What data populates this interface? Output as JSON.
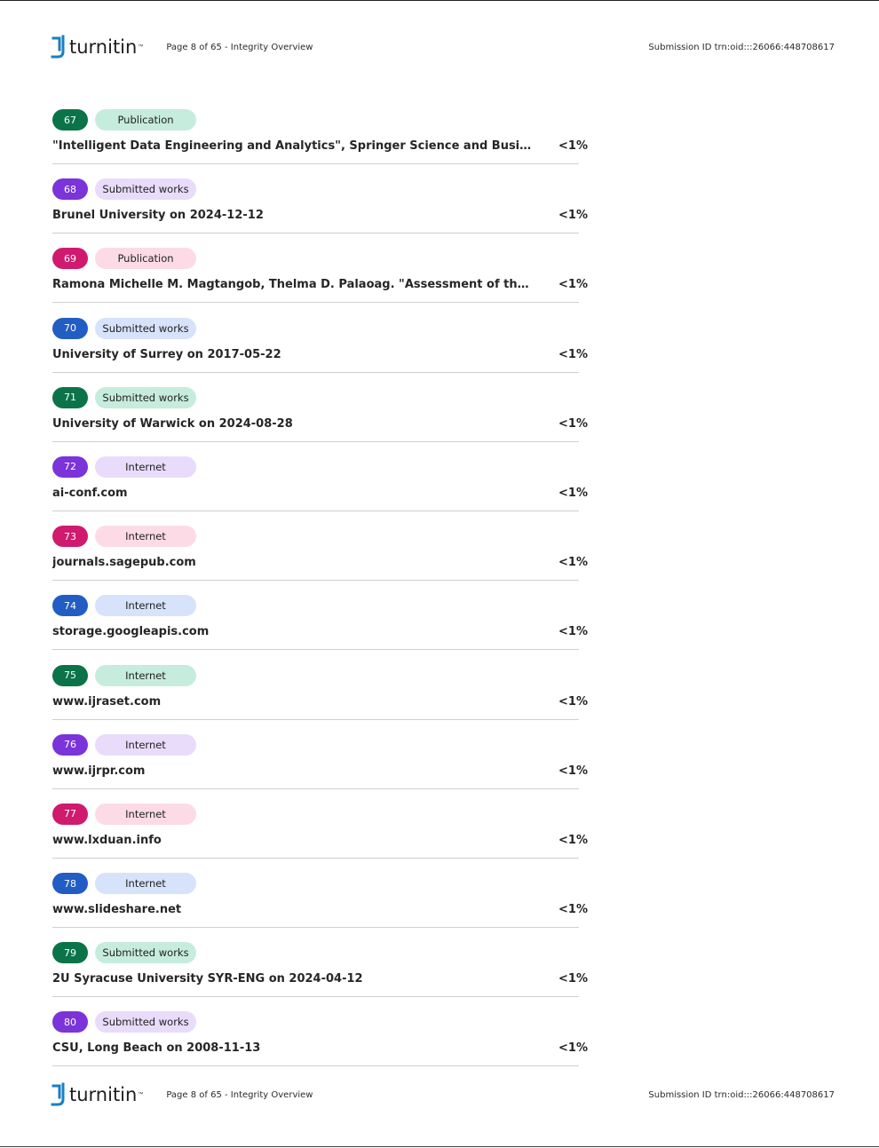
{
  "header": {
    "logo_text": "turnitin",
    "page_info": "Page 8 of 65 - Integrity Overview",
    "submission_id": "Submission ID trn:oid:::26066:448708617"
  },
  "footer": {
    "logo_text": "turnitin",
    "page_info": "Page 8 of 65 - Integrity Overview",
    "submission_id": "Submission ID trn:oid:::26066:448708617"
  },
  "colors": {
    "green": "#0b7348",
    "purple": "#7a34d9",
    "pink": "#cf1a6e",
    "blue": "#225dc4",
    "logo_blue": "#1a7fc1"
  },
  "sources": [
    {
      "num": "67",
      "type": "Publication",
      "color": "green",
      "title": "\"Intelligent Data Engineering and Analytics\", Springer Science and Business Medi...",
      "pct": "<1%"
    },
    {
      "num": "68",
      "type": "Submitted works",
      "color": "purple",
      "title": "Brunel University on 2024-12-12",
      "pct": "<1%"
    },
    {
      "num": "69",
      "type": "Publication",
      "color": "pink",
      "title": "Ramona Michelle M. Magtangob, Thelma D. Palaoag. \"Assessment of the Healthc...",
      "pct": "<1%"
    },
    {
      "num": "70",
      "type": "Submitted works",
      "color": "blue",
      "title": "University of Surrey on 2017-05-22",
      "pct": "<1%"
    },
    {
      "num": "71",
      "type": "Submitted works",
      "color": "green",
      "title": "University of Warwick on 2024-08-28",
      "pct": "<1%"
    },
    {
      "num": "72",
      "type": "Internet",
      "color": "purple",
      "title": "ai-conf.com",
      "pct": "<1%"
    },
    {
      "num": "73",
      "type": "Internet",
      "color": "pink",
      "title": "journals.sagepub.com",
      "pct": "<1%"
    },
    {
      "num": "74",
      "type": "Internet",
      "color": "blue",
      "title": "storage.googleapis.com",
      "pct": "<1%"
    },
    {
      "num": "75",
      "type": "Internet",
      "color": "green",
      "title": "www.ijraset.com",
      "pct": "<1%"
    },
    {
      "num": "76",
      "type": "Internet",
      "color": "purple",
      "title": "www.ijrpr.com",
      "pct": "<1%"
    },
    {
      "num": "77",
      "type": "Internet",
      "color": "pink",
      "title": "www.lxduan.info",
      "pct": "<1%"
    },
    {
      "num": "78",
      "type": "Internet",
      "color": "blue",
      "title": "www.slideshare.net",
      "pct": "<1%"
    },
    {
      "num": "79",
      "type": "Submitted works",
      "color": "green",
      "title": "2U Syracuse University SYR-ENG on 2024-04-12",
      "pct": "<1%"
    },
    {
      "num": "80",
      "type": "Submitted works",
      "color": "purple",
      "title": "CSU, Long Beach on 2008-11-13",
      "pct": "<1%"
    }
  ]
}
